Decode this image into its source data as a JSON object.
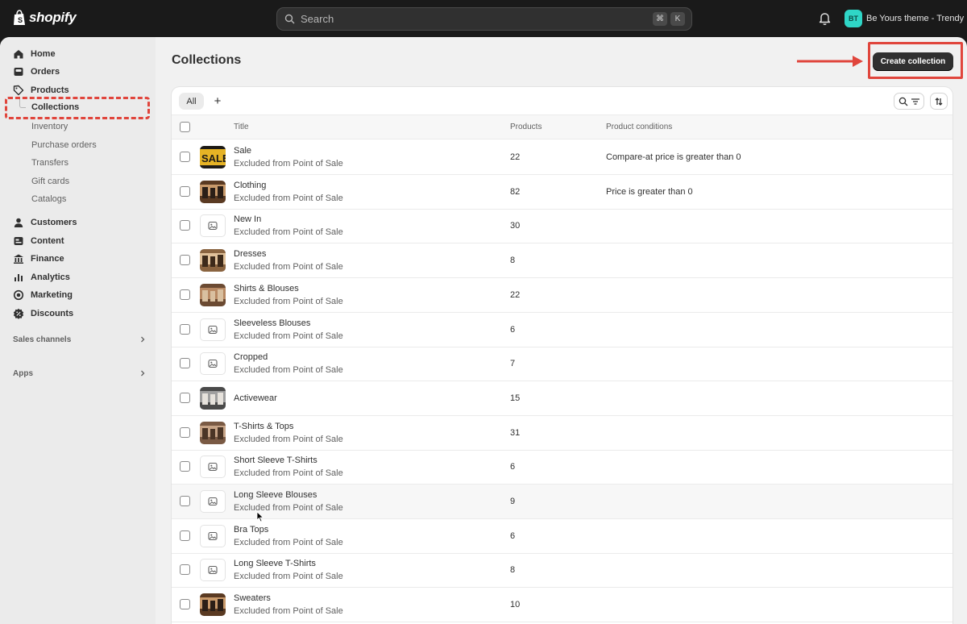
{
  "topbar": {
    "logo_text": "shopify",
    "search_placeholder": "Search",
    "shortcut_keys": [
      "⌘",
      "K"
    ],
    "store_initials": "BT",
    "store_name": "Be Yours theme - Trendy"
  },
  "sidebar": {
    "home": "Home",
    "orders": "Orders",
    "products": "Products",
    "collections": "Collections",
    "inventory": "Inventory",
    "purchase_orders": "Purchase orders",
    "transfers": "Transfers",
    "gift_cards": "Gift cards",
    "catalogs": "Catalogs",
    "customers": "Customers",
    "content": "Content",
    "finance": "Finance",
    "analytics": "Analytics",
    "marketing": "Marketing",
    "discounts": "Discounts",
    "sales_channels": "Sales channels",
    "apps": "Apps"
  },
  "page": {
    "title": "Collections",
    "create_label": "Create collection"
  },
  "tabs": {
    "all": "All",
    "add": "+"
  },
  "table": {
    "headers": {
      "title": "Title",
      "products": "Products",
      "conditions": "Product conditions"
    },
    "rows": [
      {
        "title": "Sale",
        "subtitle": "Excluded from Point of Sale",
        "count": "22",
        "condition": "Compare-at price is greater than 0",
        "thumb": "sale"
      },
      {
        "title": "Clothing",
        "subtitle": "Excluded from Point of Sale",
        "count": "82",
        "condition": "Price is greater than 0",
        "thumb": "photo"
      },
      {
        "title": "New In",
        "subtitle": "Excluded from Point of Sale",
        "count": "30",
        "condition": "",
        "thumb": "placeholder"
      },
      {
        "title": "Dresses",
        "subtitle": "Excluded from Point of Sale",
        "count": "8",
        "condition": "",
        "thumb": "photo"
      },
      {
        "title": "Shirts & Blouses",
        "subtitle": "Excluded from Point of Sale",
        "count": "22",
        "condition": "",
        "thumb": "photo"
      },
      {
        "title": "Sleeveless Blouses",
        "subtitle": "Excluded from Point of Sale",
        "count": "6",
        "condition": "",
        "thumb": "placeholder"
      },
      {
        "title": "Cropped",
        "subtitle": "Excluded from Point of Sale",
        "count": "7",
        "condition": "",
        "thumb": "placeholder"
      },
      {
        "title": "Activewear",
        "subtitle": "",
        "count": "15",
        "condition": "",
        "thumb": "photo"
      },
      {
        "title": "T-Shirts & Tops",
        "subtitle": "Excluded from Point of Sale",
        "count": "31",
        "condition": "",
        "thumb": "photo"
      },
      {
        "title": "Short Sleeve T-Shirts",
        "subtitle": "Excluded from Point of Sale",
        "count": "6",
        "condition": "",
        "thumb": "placeholder"
      },
      {
        "title": "Long Sleeve Blouses",
        "subtitle": "Excluded from Point of Sale",
        "count": "9",
        "condition": "",
        "thumb": "placeholder"
      },
      {
        "title": "Bra Tops",
        "subtitle": "Excluded from Point of Sale",
        "count": "6",
        "condition": "",
        "thumb": "placeholder"
      },
      {
        "title": "Long Sleeve T-Shirts",
        "subtitle": "Excluded from Point of Sale",
        "count": "8",
        "condition": "",
        "thumb": "placeholder"
      },
      {
        "title": "Sweaters",
        "subtitle": "Excluded from Point of Sale",
        "count": "10",
        "condition": "",
        "thumb": "photo"
      }
    ]
  },
  "colors": {
    "accent": "#303030",
    "annotation": "#e0453c",
    "avatar": "#2fd6c7"
  },
  "icons": [
    "shopify-logo-icon",
    "search-icon",
    "bell-icon",
    "home-icon",
    "orders-icon",
    "tag-icon",
    "person-icon",
    "content-icon",
    "finance-icon",
    "analytics-icon",
    "marketing-icon",
    "discount-icon",
    "chevron-right-icon",
    "filter-icon",
    "sort-icon",
    "image-placeholder-icon"
  ]
}
